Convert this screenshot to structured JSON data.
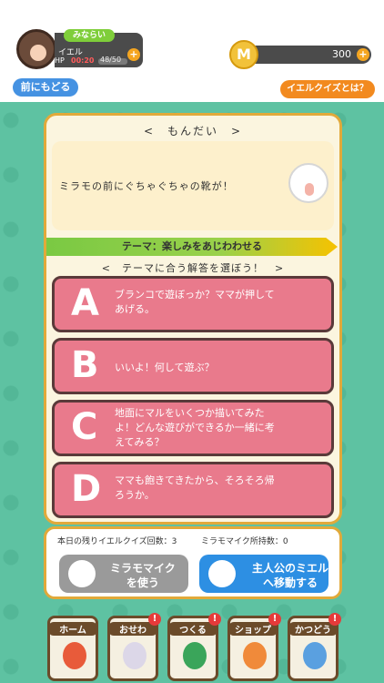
{
  "header": {
    "rank": "みならい",
    "username": "イエル",
    "hp_label": "HP",
    "hp_timer": "00:20",
    "hp_value": "48/50",
    "plus_label": "+",
    "coin_symbol": "M",
    "coins": "300"
  },
  "buttons": {
    "back": "前にもどる",
    "about": "イエルクイズとは？"
  },
  "question": {
    "heading": "<　もんだい　>",
    "text": "ミラモの前にぐちゃぐちゃの靴が！",
    "theme": "テーマ：楽しみをあじわわせる",
    "instruction": "<　テーマに合う解答を選ぼう！　>"
  },
  "answers": [
    {
      "letter": "A",
      "text": "ブランコで遊ぼっか？ママが押して\nあげる。"
    },
    {
      "letter": "B",
      "text": "いいよ！何して遊ぶ？"
    },
    {
      "letter": "C",
      "text": "地面にマルをいくつか描いてみた\nよ！どんな遊びができるか一緒に考\nえてみる？"
    },
    {
      "letter": "D",
      "text": "ママも飽きてきたから、そろそろ帰\nろうか。"
    }
  ],
  "footer": {
    "remaining": "本日の残りイエルクイズ回数：3",
    "owned": "ミラモマイク所持数：0",
    "mic_line1": "ミラモマイク",
    "mic_line2": "を使う",
    "move_line1": "主人公のミエル",
    "move_line2": "へ移動する"
  },
  "nav": [
    {
      "label": "ホーム",
      "alert": ""
    },
    {
      "label": "おせわ",
      "alert": "!"
    },
    {
      "label": "つくる",
      "alert": "!"
    },
    {
      "label": "ショップ",
      "alert": "!"
    },
    {
      "label": "かつどう",
      "alert": "!"
    }
  ],
  "icons": {
    "coin": "coin-icon",
    "mic": "microphone-icon",
    "move": "handshake-icon",
    "home": "house-icon",
    "care": "ghost-icon",
    "make": "leaf-icon",
    "shop": "store-icon",
    "activity": "cup-icon"
  },
  "colors": {
    "background": "#5ec2a2",
    "panel": "#fbf5df",
    "answer": "#e97a8c",
    "accent": "#e1a93a"
  }
}
